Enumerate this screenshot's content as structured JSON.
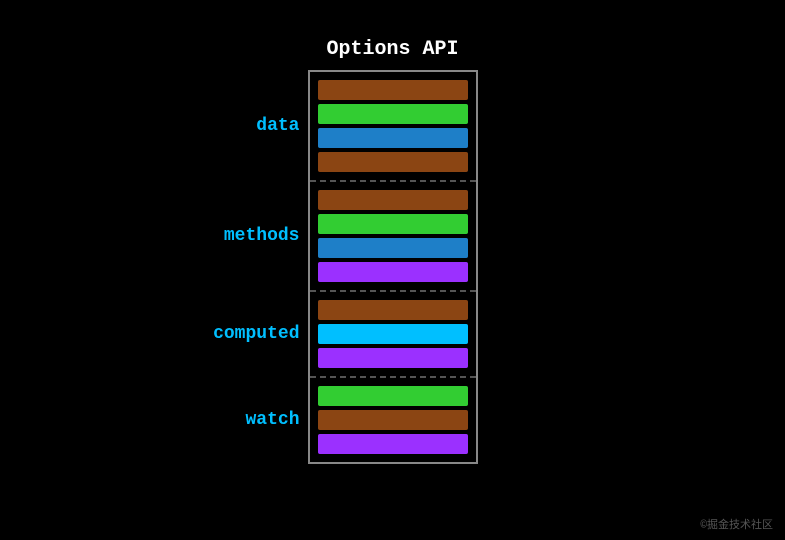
{
  "title": "Options API",
  "watermark": "©掘金技术社区",
  "sections": [
    {
      "label": "data",
      "bars": [
        "brown",
        "green",
        "blue",
        "brown"
      ]
    },
    {
      "label": "methods",
      "bars": [
        "brown",
        "green",
        "blue",
        "purple"
      ]
    },
    {
      "label": "computed",
      "bars": [
        "brown",
        "cyan",
        "purple"
      ]
    },
    {
      "label": "watch",
      "bars": [
        "green",
        "brown",
        "purple"
      ]
    }
  ],
  "colors": {
    "brown": "#8B4513",
    "green": "#32CD32",
    "blue": "#1E7FC8",
    "purple": "#9B30FF",
    "cyan": "#00BFFF"
  }
}
